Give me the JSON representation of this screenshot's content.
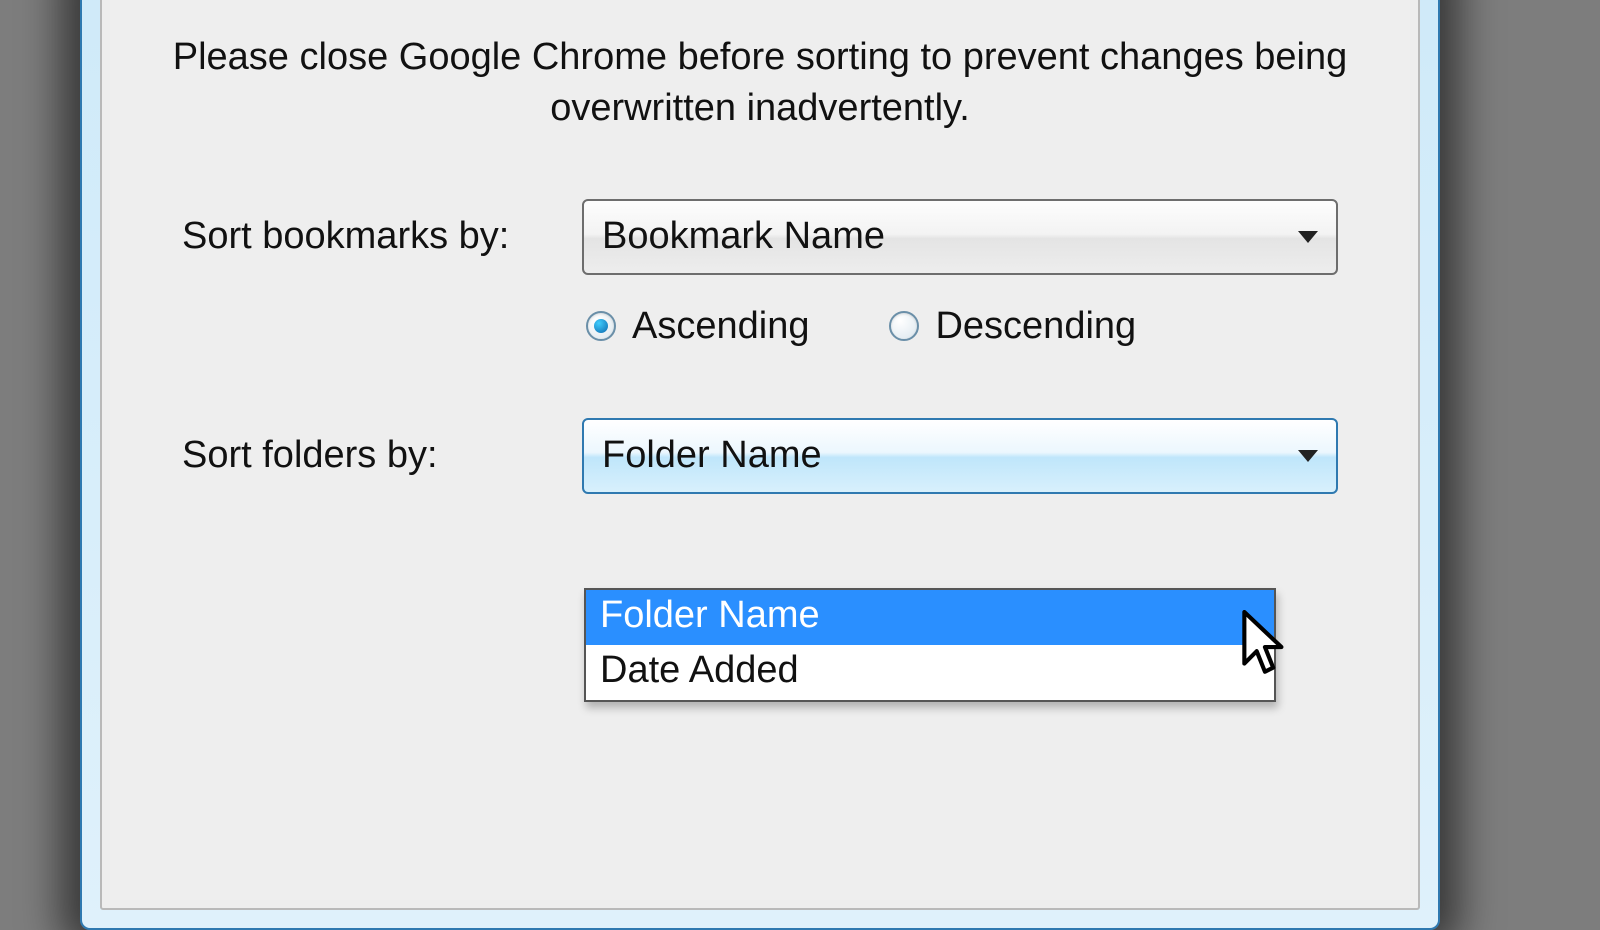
{
  "instruction_text": "Please close Google Chrome before sorting to prevent changes being overwritten inadvertently.",
  "sort_bookmarks": {
    "label": "Sort bookmarks by:",
    "selected": "Bookmark Name"
  },
  "order_radio": {
    "ascending_label": "Ascending",
    "descending_label": "Descending",
    "selected": "Ascending"
  },
  "sort_folders": {
    "label": "Sort folders by:",
    "selected": "Folder Name",
    "options": [
      "Folder Name",
      "Date Added"
    ],
    "highlighted_option": "Folder Name",
    "open": true
  }
}
